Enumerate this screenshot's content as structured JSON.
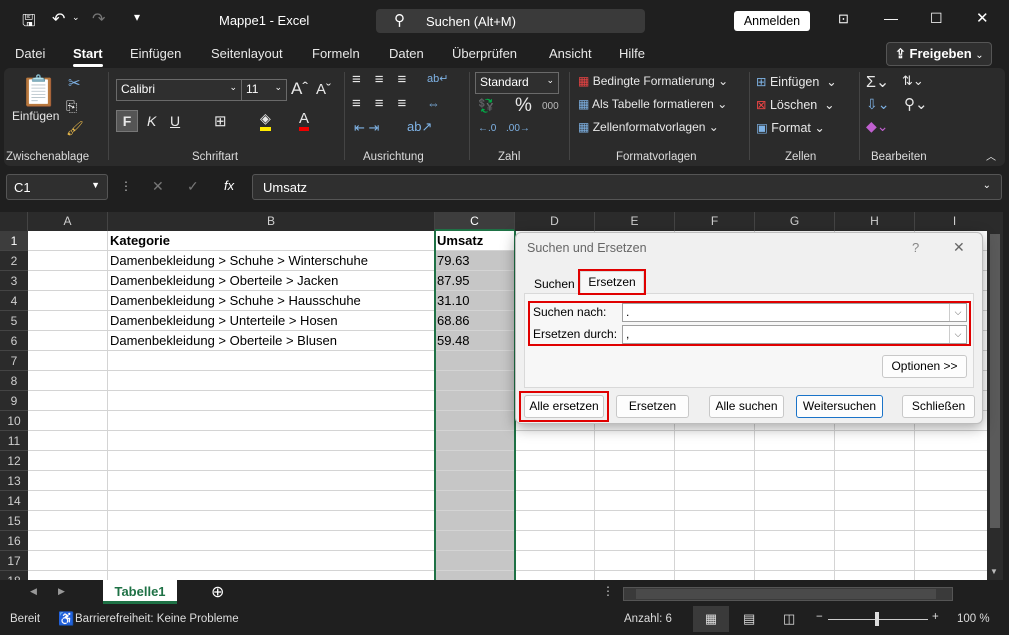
{
  "window": {
    "title": "Mappe1 - Excel",
    "search_placeholder": "Suchen (Alt+M)",
    "signin": "Anmelden"
  },
  "ribbon_tabs": [
    "Datei",
    "Start",
    "Einfügen",
    "Seitenlayout",
    "Formeln",
    "Daten",
    "Überprüfen",
    "Ansicht",
    "Hilfe"
  ],
  "share_button": "Freigeben",
  "ribbon": {
    "paste": "Einfügen",
    "font_name": "Calibri",
    "font_size": "11",
    "bold": "F",
    "italic": "K",
    "underline": "U",
    "number_format": "Standard",
    "cond_format": "Bedingte Formatierung",
    "as_table": "Als Tabelle formatieren",
    "cell_styles": "Zellenformatvorlagen",
    "insert": "Einfügen",
    "delete": "Löschen",
    "format": "Format",
    "groups": [
      "Zwischenablage",
      "Schriftart",
      "Ausrichtung",
      "Zahl",
      "Formatvorlagen",
      "Zellen",
      "Bearbeiten"
    ]
  },
  "formula_bar": {
    "name_box": "C1",
    "fx": "fx",
    "value": "Umsatz"
  },
  "columns": [
    "A",
    "B",
    "C",
    "D",
    "E",
    "F",
    "G",
    "H",
    "I"
  ],
  "rows": [
    [
      "",
      "Kategorie",
      "Umsatz"
    ],
    [
      "",
      "Damenbekleidung > Schuhe > Winterschuhe",
      "79.63"
    ],
    [
      "",
      "Damenbekleidung > Oberteile > Jacken",
      "87.95"
    ],
    [
      "",
      "Damenbekleidung > Schuhe > Hausschuhe",
      "31.10"
    ],
    [
      "",
      "Damenbekleidung > Unterteile > Hosen",
      "68.86"
    ],
    [
      "",
      "Damenbekleidung > Oberteile > Blusen",
      "59.48"
    ]
  ],
  "row_count": 18,
  "dialog": {
    "title": "Suchen und Ersetzen",
    "help": "?",
    "close": "✕",
    "tab_find": "Suchen",
    "tab_replace": "Ersetzen",
    "find_label": "Suchen nach:",
    "find_value": ".",
    "replace_label": "Ersetzen durch:",
    "replace_value": ",",
    "options": "Optionen >>",
    "buttons": [
      "Alle ersetzen",
      "Ersetzen",
      "Alle suchen",
      "Weitersuchen",
      "Schließen"
    ]
  },
  "sheet_tab": "Tabelle1",
  "status": {
    "ready": "Bereit",
    "accessibility": "Barrierefreiheit: Keine Probleme",
    "count": "Anzahl: 6",
    "zoom": "100 %",
    "zoom_level_percent": 100
  },
  "colors": {
    "accent": "#1e7145",
    "highlight": "#e00000"
  }
}
